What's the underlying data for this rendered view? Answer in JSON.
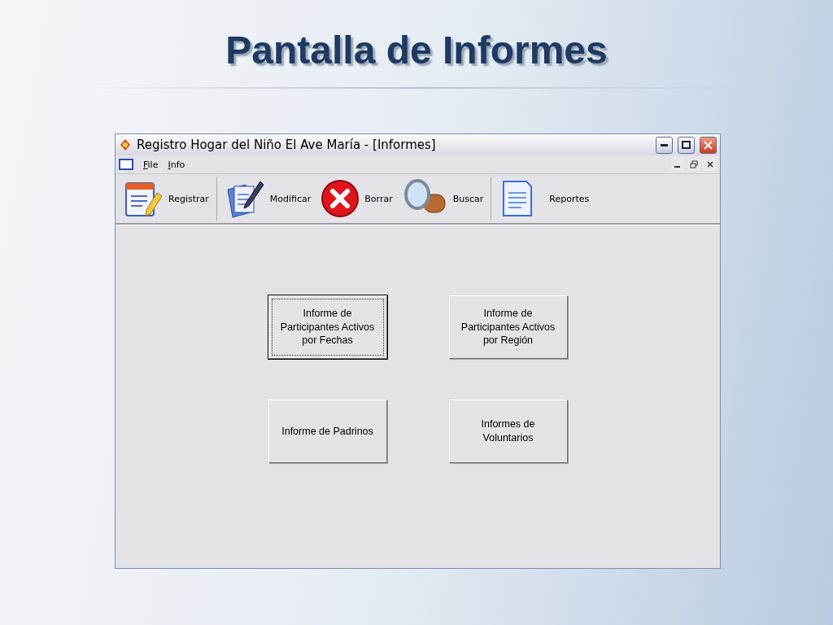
{
  "slide": {
    "title": "Pantalla de Informes"
  },
  "window": {
    "title": "Registro Hogar del Niño El Ave María - [Informes]"
  },
  "menu": [
    {
      "label": "File"
    },
    {
      "label": "Info"
    }
  ],
  "toolbar_groups": [
    [
      {
        "kind": "register",
        "label": "Registrar"
      }
    ],
    [
      {
        "kind": "edit",
        "label": "Modificar"
      },
      {
        "kind": "delete",
        "label": "Borrar"
      },
      {
        "kind": "search",
        "label": "Buscar"
      }
    ],
    [
      {
        "kind": "report",
        "label": "Reportes"
      }
    ]
  ],
  "report_button_rows": [
    [
      {
        "label": "Informe de\nParticipantes Activos\npor Fechas",
        "focused": true
      },
      {
        "label": "Informe de\nParticipantes Activos\npor Región",
        "focused": false
      }
    ],
    [
      {
        "label": "Informe de Padrinos",
        "focused": false
      },
      {
        "label": "Informes de\nVoluntarios",
        "focused": false
      }
    ]
  ]
}
